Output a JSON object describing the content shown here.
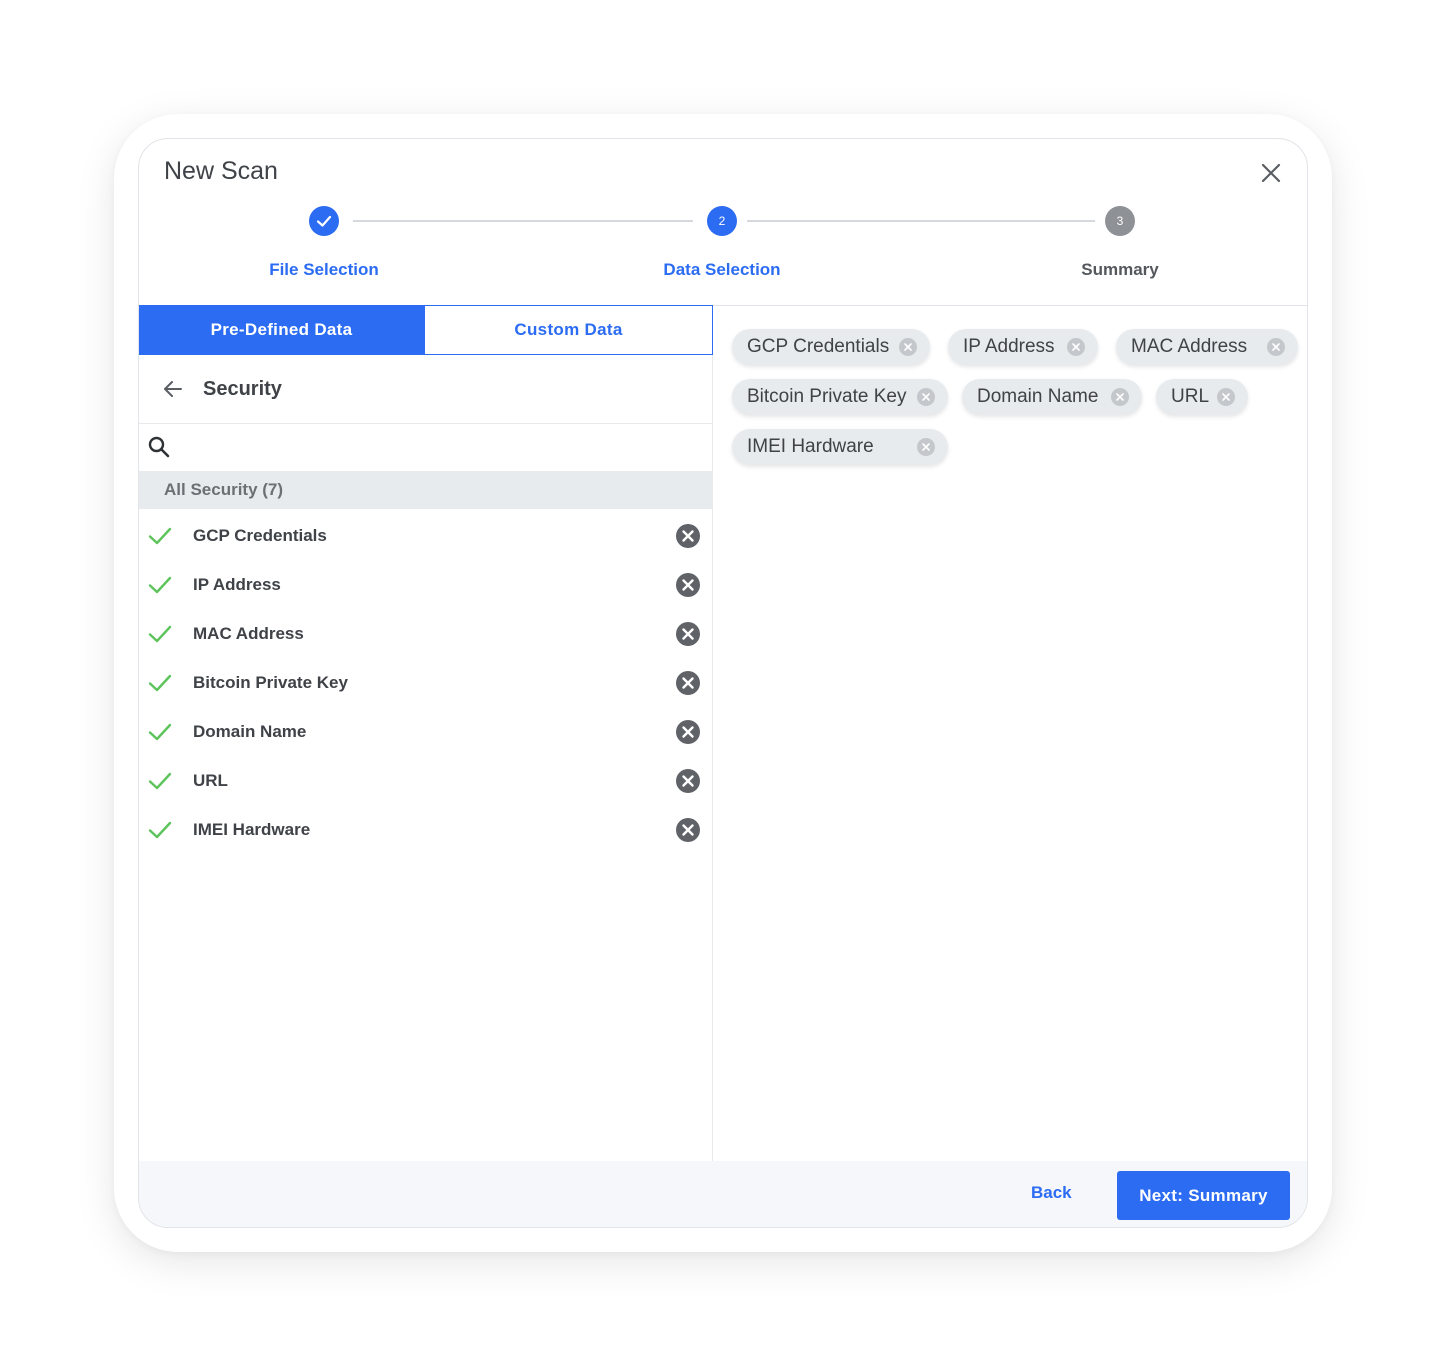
{
  "dialog": {
    "title": "New Scan"
  },
  "stepper": {
    "steps": [
      {
        "label": "File Selection",
        "state": "done",
        "number": ""
      },
      {
        "label": "Data Selection",
        "state": "active",
        "number": "2"
      },
      {
        "label": "Summary",
        "state": "pending",
        "number": "3"
      }
    ]
  },
  "tabs": {
    "predefined": "Pre-Defined Data",
    "custom": "Custom Data",
    "active": "predefined"
  },
  "category": {
    "title": "Security",
    "group_label": "All Security (7)"
  },
  "search": {
    "value": "",
    "placeholder": ""
  },
  "items": [
    "GCP Credentials",
    "IP Address",
    "MAC Address",
    "Bitcoin Private Key",
    "Domain Name",
    "URL",
    "IMEI Hardware"
  ],
  "chips": [
    "GCP Credentials",
    "IP Address",
    "MAC Address",
    "Bitcoin Private Key",
    "Domain Name",
    "URL",
    "IMEI Hardware"
  ],
  "footer": {
    "back_label": "Back",
    "next_label": "Next: Summary"
  },
  "colors": {
    "accent": "#2b6cf3",
    "check": "#5cc45a",
    "pending": "#8e9296"
  }
}
